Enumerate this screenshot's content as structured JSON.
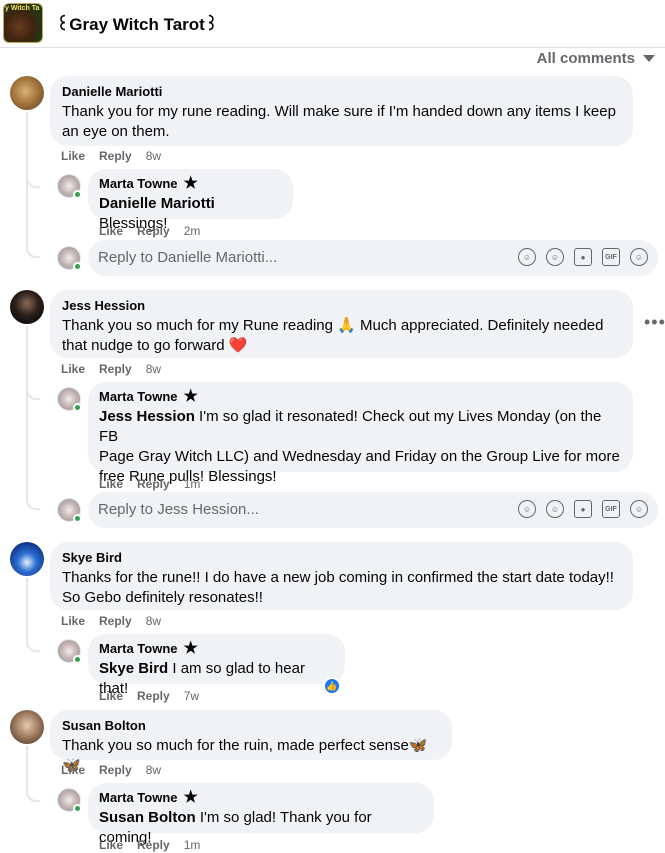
{
  "header": {
    "title": "꒰Gray Witch Tarot꒱",
    "avatar_text": "y Witch Ta"
  },
  "all_comments": "All comments",
  "like_label": "Like",
  "reply_label": "Reply",
  "comments": [
    {
      "author": "Danielle Mariotti",
      "lines": [
        "Thank you for my rune reading. Will make sure if I'm handed down any items I keep",
        "an eye on them."
      ],
      "time": "8w",
      "reply": {
        "author": "Marta Towne",
        "mention": "Danielle Mariotti",
        "lines": [
          " Blessings!"
        ],
        "time": "2m"
      },
      "reply_placeholder": "Reply to Danielle Mariotti..."
    },
    {
      "author": "Jess Hession",
      "lines": [
        "Thank you so much for my Rune reading 🙏 Much appreciated. Definitely needed",
        "that nudge to go forward ❤️"
      ],
      "time": "8w",
      "reply": {
        "author": "Marta Towne",
        "mention": "Jess Hession",
        "lines": [
          " I'm so glad it resonated! Check out my Lives Monday (on the FB",
          "Page Gray Witch LLC) and Wednesday and Friday on the Group Live for more",
          "free Rune pulls! Blessings!"
        ],
        "time": "1m"
      },
      "reply_placeholder": "Reply to Jess Hession..."
    },
    {
      "author": "Skye Bird",
      "lines": [
        "Thanks for the rune!! I do have a new job coming in confirmed the start date today!!",
        "So Gebo definitely resonates!!"
      ],
      "time": "8w",
      "reply": {
        "author": "Marta Towne",
        "mention": "Skye Bird",
        "lines": [
          " I am so glad to hear that!"
        ],
        "time": "7w"
      }
    },
    {
      "author": "Susan Bolton",
      "lines": [
        "Thank you so much for the ruin, made perfect sense🦋🦋"
      ],
      "time": "8w",
      "reply": {
        "author": "Marta Towne",
        "mention": "Susan Bolton",
        "lines": [
          " I'm so glad! Thank you for coming!"
        ],
        "time": "1m"
      }
    }
  ],
  "more_options": "•••",
  "reply_icons": [
    "sticker-icon",
    "emoji-icon",
    "camera-icon",
    "gif-icon",
    "avatar-sticker-icon"
  ],
  "gif_text": "GIF",
  "colors": {
    "accent": "#1877f2",
    "bubble": "#f0f2f5",
    "muted": "#65676b",
    "online": "#31a24c"
  }
}
